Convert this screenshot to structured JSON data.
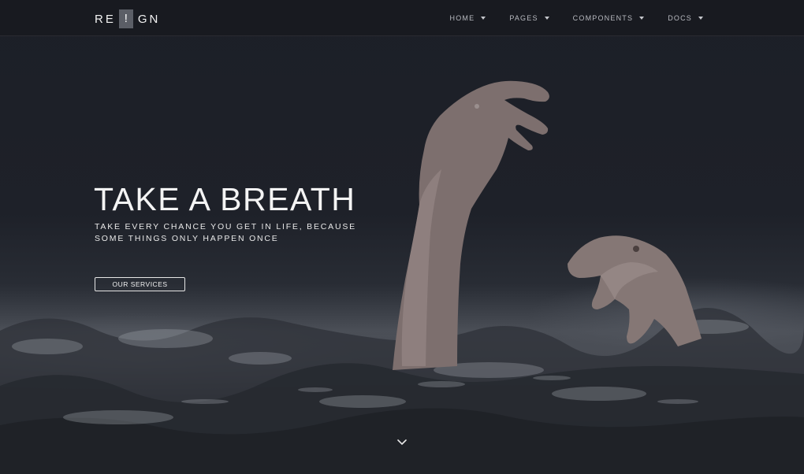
{
  "brand": {
    "logo_left": "RE",
    "logo_mark": "!",
    "logo_right": "GN"
  },
  "nav": {
    "items": [
      {
        "label": "HOME",
        "icon": "caret-down-icon"
      },
      {
        "label": "PAGES",
        "icon": "caret-down-icon"
      },
      {
        "label": "COMPONENTS",
        "icon": "caret-down-icon"
      },
      {
        "label": "DOCS",
        "icon": "caret-down-icon"
      }
    ]
  },
  "hero": {
    "title": "TAKE A BREATH",
    "subtitle_line1": "TAKE EVERY CHANCE YOU GET IN LIFE, BECAUSE",
    "subtitle_line2": "SOME THINGS ONLY HAPPEN ONCE",
    "cta_label": "OUR SERVICES",
    "scroll_icon": "chevron-down-icon"
  },
  "colors": {
    "background": "#1c1f27",
    "text": "#f4f4f4",
    "logo_mark_bg": "#5b5e66"
  }
}
